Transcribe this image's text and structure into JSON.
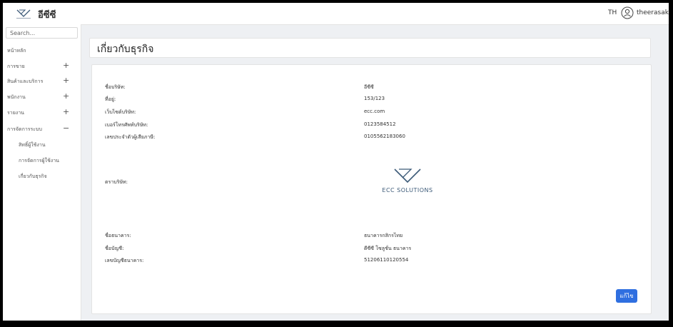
{
  "topbar": {
    "brand": "อีซีซี",
    "language": "TH",
    "username": "theerasak"
  },
  "sidebar": {
    "search_placeholder": "Search...",
    "items": [
      {
        "label": "หน้าหลัก",
        "sign": ""
      },
      {
        "label": "การขาย",
        "sign": "+"
      },
      {
        "label": "สินค้าและบริการ",
        "sign": "+"
      },
      {
        "label": "พนักงาน",
        "sign": "+"
      },
      {
        "label": "รายงาน",
        "sign": "+"
      },
      {
        "label": "การจัดการระบบ",
        "sign": "−"
      }
    ],
    "subitems": [
      {
        "label": "สิทธิ์ผู้ใช้งาน"
      },
      {
        "label": "การจัดการผู้ใช้งาน"
      },
      {
        "label": "เกี่ยวกับธุรกิจ"
      }
    ]
  },
  "page": {
    "title": "เกี่ยวกับธุรกิจ"
  },
  "business": {
    "fields": [
      {
        "label": "ชื่อบริษัท:",
        "value": "อีซีซี"
      },
      {
        "label": "ที่อยู่:",
        "value": "153/123"
      },
      {
        "label": "เว็บไซต์บริษัท:",
        "value": "ecc.com"
      },
      {
        "label": "เบอร์โทรศัพท์บริษัท:",
        "value": "0123584512"
      },
      {
        "label": "เลขประจำตัวผู้เสียภาษี:",
        "value": "0105562183060"
      }
    ],
    "logo_label": "ตราบริษัท:",
    "logo_text": "ECC SOLUTIONS",
    "bank_fields": [
      {
        "label": "ชื่อธนาคาร:",
        "value": "ธนาคารกสิกรไทย"
      },
      {
        "label": "ชื่อบัญชี:",
        "value": "ดีซีซี โซลูชั่น ธนาคาร"
      },
      {
        "label": "เลขบัญชีธนาคาร:",
        "value": "51206110120554"
      }
    ],
    "edit_label": "แก้ไข"
  },
  "colors": {
    "accent": "#2f6fe0",
    "logo": "#3c5a78"
  }
}
